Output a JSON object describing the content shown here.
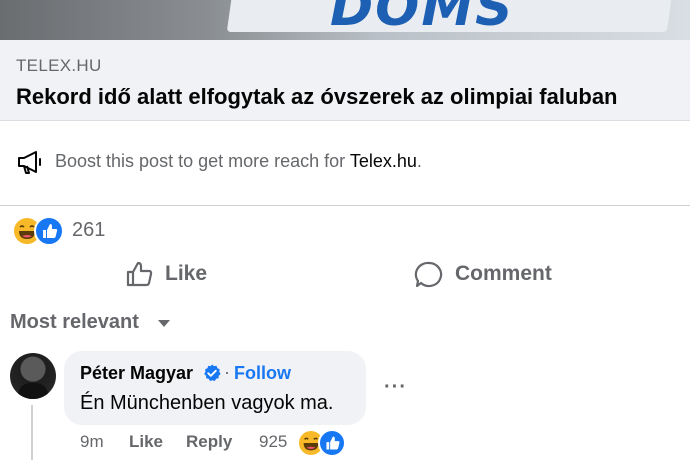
{
  "hero": {
    "sign_text": "DOMS"
  },
  "link": {
    "domain": "TELEX.HU",
    "headline": "Rekord idő alatt elfogytak az óvszerek az olimpiai faluban"
  },
  "boost": {
    "prefix": "Boost this post to get more reach for ",
    "page": "Telex.hu",
    "suffix": "."
  },
  "reactions": {
    "count": "261",
    "icons": [
      "haha-reaction-icon",
      "like-reaction-icon"
    ]
  },
  "actions": {
    "like": "Like",
    "comment": "Comment"
  },
  "sort": {
    "label": "Most relevant"
  },
  "comment": {
    "author": "Péter Magyar",
    "follow": "Follow",
    "text": "Én Münchenben vagyok ma.",
    "more": "···",
    "time": "9m",
    "like": "Like",
    "reply": "Reply",
    "reaction_count": "925"
  },
  "colors": {
    "accent": "#1877f2",
    "muted": "#65676b",
    "card": "#f0f2f5"
  }
}
